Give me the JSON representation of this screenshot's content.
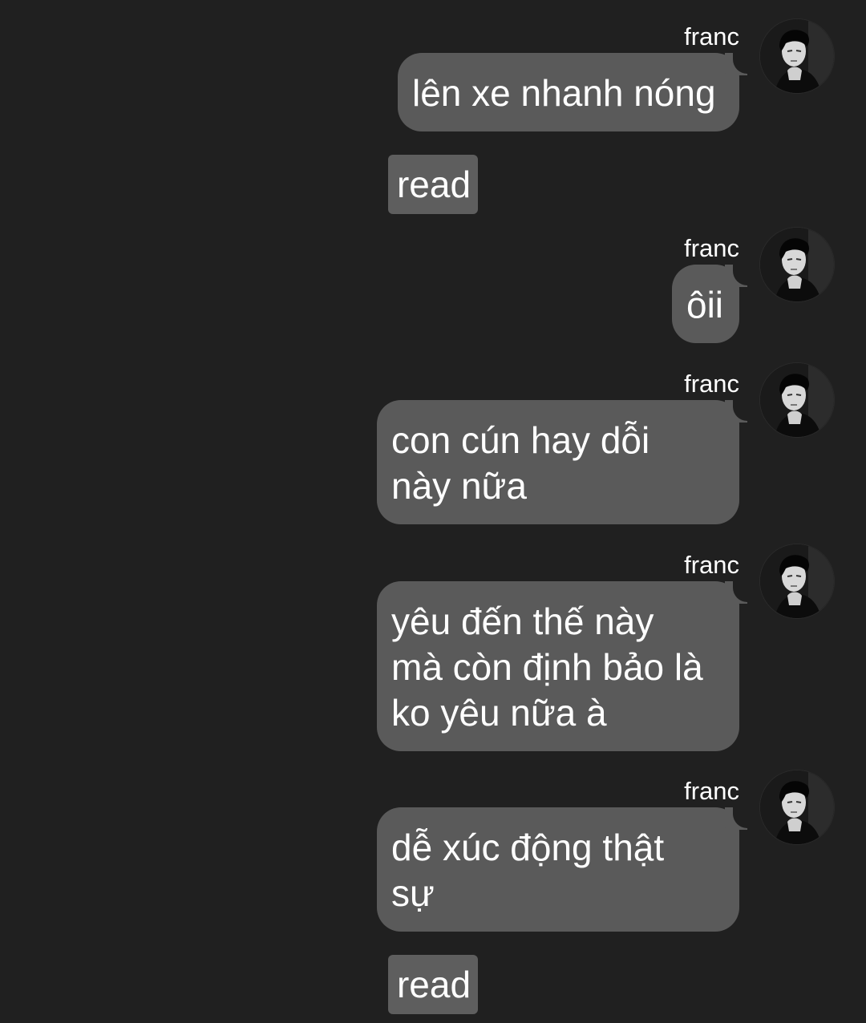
{
  "conversation": {
    "messages": [
      {
        "sender": "franc",
        "lines": [
          "lên xe nhanh nóng"
        ]
      },
      {
        "sender": "franc",
        "lines": [
          "ôii"
        ]
      },
      {
        "sender": "franc",
        "lines": [
          "con cún hay dỗi",
          "này nữa"
        ]
      },
      {
        "sender": "franc",
        "lines": [
          "yêu đến thế này",
          "mà còn định bảo là",
          "ko yêu nữa à"
        ]
      },
      {
        "sender": "franc",
        "lines": [
          "dễ xúc động thật",
          "sự"
        ]
      }
    ],
    "receipts": [
      "read",
      "read"
    ]
  },
  "colors": {
    "background": "#202020",
    "bubble": "#5a5a5a",
    "read_badge": "#5e5e5e",
    "text": "#ffffff"
  },
  "icons": {
    "avatar": "profile-photo-grayscale-man"
  }
}
